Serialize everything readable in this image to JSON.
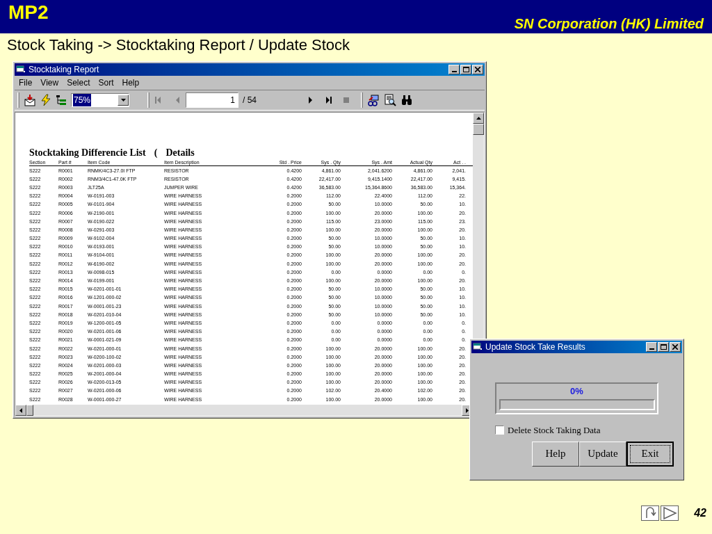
{
  "slide": {
    "logo": "MP2",
    "company": "SN Corporation (HK) Limited",
    "subtitle": "Stock Taking -> Stocktaking Report / Update Stock",
    "page_number": "42"
  },
  "report_window": {
    "title": "Stocktaking Report",
    "menu": [
      "File",
      "View",
      "Select",
      "Sort",
      "Help"
    ],
    "toolbar": {
      "zoom": {
        "value": "75%",
        "selected": true
      },
      "page": "1",
      "page_total": "/ 54"
    },
    "report": {
      "title": "Stocktaking Differencie List",
      "title_suffix": "(",
      "title_detail": "Details",
      "columns": [
        "Section",
        "Part #",
        "Item Code",
        "Item Description",
        "Std . Price",
        "Sys . Qty",
        "Sys . Amt",
        "Actual Qty",
        "Act . ."
      ],
      "rows": [
        [
          "S222",
          "R0001",
          "RNMK/4C3-27.0I FTP",
          "RESISTOR",
          "0.4200",
          "4,861.00",
          "2,041.6200",
          "4,861.00",
          "2,041."
        ],
        [
          "S222",
          "R0002",
          "RNM3/4C1-47.0K FTP",
          "RESISTOR",
          "0.4200",
          "22,417.00",
          "9,415.1400",
          "22,417.00",
          "9,415."
        ],
        [
          "S222",
          "R0003",
          "JLT25A",
          "JUMPER WIRE",
          "0.4200",
          "36,583.00",
          "15,364.8600",
          "36,583.00",
          "15,364."
        ],
        [
          "S222",
          "R0004",
          "W-0191-003",
          "WIRE HARNESS",
          "0.2000",
          "112.00",
          "22.4000",
          "112.00",
          "22."
        ],
        [
          "S222",
          "R0005",
          "W-0101-904",
          "WIRE HARNESS",
          "0.2000",
          "50.00",
          "10.0000",
          "50.00",
          "10."
        ],
        [
          "S222",
          "R0006",
          "W-2190-001",
          "WIRE HARNESS",
          "0.2000",
          "100.00",
          "20.0000",
          "100.00",
          "20."
        ],
        [
          "S222",
          "R0007",
          "W-0190-022",
          "WIRE HARNESS",
          "0.2000",
          "115.00",
          "23.0000",
          "115.00",
          "23."
        ],
        [
          "S222",
          "R0008",
          "W-0291-003",
          "WIRE HARNESS",
          "0.2000",
          "100.00",
          "20.0000",
          "100.00",
          "20."
        ],
        [
          "S222",
          "R0009",
          "W-9102-004",
          "WIRE HARNESS",
          "0.2000",
          "50.00",
          "10.0000",
          "50.00",
          "10."
        ],
        [
          "S222",
          "R0010",
          "W-0193-001",
          "WIRE HARNESS",
          "0.2000",
          "50.00",
          "10.0000",
          "50.00",
          "10."
        ],
        [
          "S222",
          "R0011",
          "W-9104-001",
          "WIRE HARNESS",
          "0.2000",
          "100.00",
          "20.0000",
          "100.00",
          "20."
        ],
        [
          "S222",
          "R0012",
          "W-6190-002",
          "WIRE HARNESS",
          "0.2000",
          "100.00",
          "20.0000",
          "100.00",
          "20."
        ],
        [
          "S222",
          "R0013",
          "W-0098-015",
          "WIRE HARNESS",
          "0.2000",
          "0.00",
          "0.0000",
          "0.00",
          "0."
        ],
        [
          "S222",
          "R0014",
          "W-0199-001",
          "WIRE HARNESS",
          "0.2000",
          "100.00",
          "20.0000",
          "100.00",
          "20."
        ],
        [
          "S222",
          "R0015",
          "W-0201-001-01",
          "WIRE HARNESS",
          "0.2000",
          "50.00",
          "10.0000",
          "50.00",
          "10."
        ],
        [
          "S222",
          "R0016",
          "W-1201-000-02",
          "WIRE HARNESS",
          "0.2000",
          "50.00",
          "10.0000",
          "50.00",
          "10."
        ],
        [
          "S222",
          "R0017",
          "W-0001-001-23",
          "WIRE HARNESS",
          "0.2000",
          "50.00",
          "10.0000",
          "50.00",
          "10."
        ],
        [
          "S222",
          "R0018",
          "W-0201-010-04",
          "WIRE HARNESS",
          "0.2000",
          "50.00",
          "10.0000",
          "50.00",
          "10."
        ],
        [
          "S222",
          "R0019",
          "W-1200-001-05",
          "WIRE HARNESS",
          "0.2000",
          "0.00",
          "0.0000",
          "0.00",
          "0."
        ],
        [
          "S222",
          "R0020",
          "W-0201-001-06",
          "WIRE HARNESS",
          "0.2000",
          "0.00",
          "0.0000",
          "0.00",
          "0."
        ],
        [
          "S222",
          "R0021",
          "W-0001-021-09",
          "WIRE HARNESS",
          "0.2000",
          "0.00",
          "0.0000",
          "0.00",
          "0."
        ],
        [
          "S222",
          "R0022",
          "W-0201-000-01",
          "WIRE HARNESS",
          "0.2000",
          "100.00",
          "20.0000",
          "100.00",
          "20."
        ],
        [
          "S222",
          "R0023",
          "W-0200-100-02",
          "WIRE HARNESS",
          "0.2000",
          "100.00",
          "20.0000",
          "100.00",
          "20."
        ],
        [
          "S222",
          "R0024",
          "W-0201-000-03",
          "WIRE HARNESS",
          "0.2000",
          "100.00",
          "20.0000",
          "100.00",
          "20."
        ],
        [
          "S222",
          "R0025",
          "W-2001-000-04",
          "WIRE HARNESS",
          "0.2000",
          "100.00",
          "20.0000",
          "100.00",
          "20."
        ],
        [
          "S222",
          "R0026",
          "W-0200-013-05",
          "WIRE HARNESS",
          "0.2000",
          "100.00",
          "20.0000",
          "100.00",
          "20."
        ],
        [
          "S222",
          "R0027",
          "W-0201-000-06",
          "WIRE HARNESS",
          "0.2000",
          "102.00",
          "20.4000",
          "102.00",
          "20."
        ],
        [
          "S222",
          "R0028",
          "W-0001-000-27",
          "WIRE HARNESS",
          "0.2000",
          "100.00",
          "20.0000",
          "100.00",
          "20."
        ]
      ]
    }
  },
  "dialog": {
    "title": "Update Stock Take Results",
    "progress": {
      "label": "0%",
      "level": 0
    },
    "checkbox": {
      "label": "Delete Stock Taking Data",
      "checked": false
    },
    "buttons": [
      {
        "label": "Help",
        "default": false
      },
      {
        "label": "Update",
        "default": false
      },
      {
        "label": "Exit",
        "default": true
      }
    ]
  }
}
